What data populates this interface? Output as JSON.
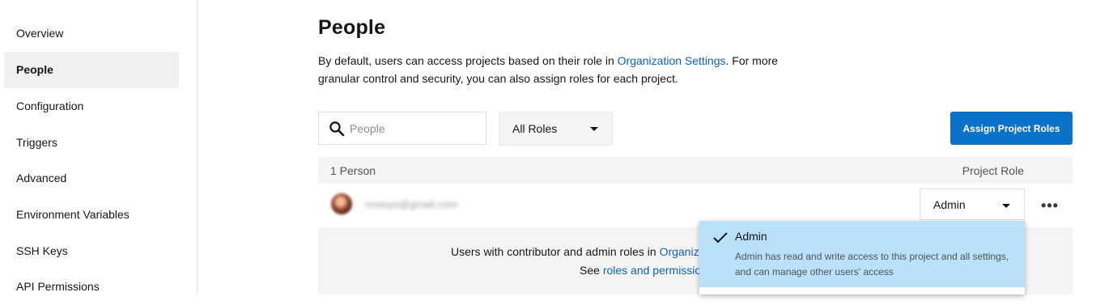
{
  "sidebar": {
    "items": [
      {
        "label": "Overview"
      },
      {
        "label": "People",
        "active": true
      },
      {
        "label": "Configuration"
      },
      {
        "label": "Triggers"
      },
      {
        "label": "Advanced"
      },
      {
        "label": "Environment Variables"
      },
      {
        "label": "SSH Keys"
      },
      {
        "label": "API Permissions"
      }
    ]
  },
  "page": {
    "title": "People",
    "intro_before": "By default, users can access projects based on their role in ",
    "intro_link": "Organization Settings",
    "intro_after": ". For more granular control and security, you can also assign roles for each project."
  },
  "toolbar": {
    "search_placeholder": "People",
    "search_icon": "search-icon",
    "roles_filter": "All Roles",
    "assign_button": "Assign Project Roles"
  },
  "table": {
    "count_label": "1 Person",
    "role_column": "Project Role",
    "rows": [
      {
        "email": "rosieyo@gmail.com",
        "role": "Admin",
        "more": "•••"
      }
    ]
  },
  "info": {
    "line1_before": "Users with contributor and admin roles in ",
    "line1_link": "Organization Settings",
    "line2_before": "See ",
    "line2_link": "roles and permissions"
  },
  "role_dropdown": {
    "selected": {
      "title": "Admin",
      "description": "Admin has read and write access to this project and all settings, and can manage other users' access",
      "icon": "checkmark-icon"
    }
  },
  "colors": {
    "accent": "#0b72c9",
    "link": "#0b61c0",
    "selected_option": "#b9e1fb"
  }
}
